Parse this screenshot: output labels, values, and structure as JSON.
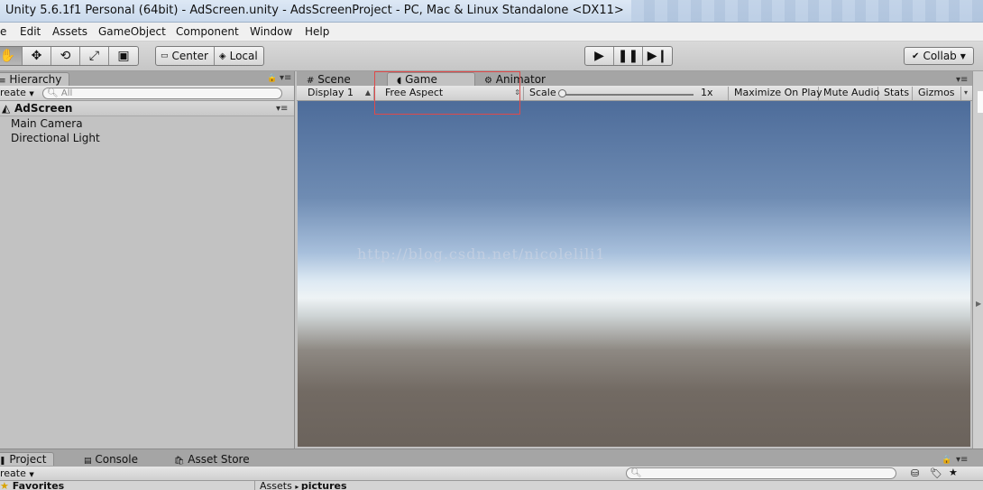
{
  "window": {
    "title": "Unity 5.6.1f1 Personal (64bit) - AdScreen.unity - AdsScreenProject - PC, Mac & Linux Standalone <DX11>"
  },
  "menu": [
    "e",
    "Edit",
    "Assets",
    "GameObject",
    "Component",
    "Window",
    "Help"
  ],
  "toolbar": {
    "transform_tools": [
      "hand-icon",
      "move-icon",
      "rotate-icon",
      "scale-icon",
      "rect-icon"
    ],
    "pivot_label": "Center",
    "space_label": "Local",
    "play_controls": [
      "play-icon",
      "pause-icon",
      "step-icon"
    ],
    "collab_label": "Collab"
  },
  "hierarchy": {
    "tab_label": "Hierarchy",
    "create_label": "reate",
    "search_placeholder": "All",
    "scene_name": "AdScreen",
    "items": [
      "Main Camera",
      "Directional Light"
    ]
  },
  "center_tabs": {
    "scene": "Scene",
    "game": "Game",
    "animator": "Animator"
  },
  "game_toolbar": {
    "display": "Display 1",
    "aspect": "Free Aspect",
    "scale_label": "Scale",
    "scale_value": "1x",
    "maximize": "Maximize On Play",
    "mute": "Mute Audio",
    "stats": "Stats",
    "gizmos": "Gizmos"
  },
  "watermark": "http://blog.csdn.net/nicolelili1",
  "project_panel": {
    "tabs": [
      "Project",
      "Console",
      "Asset Store"
    ],
    "create_label": "reate",
    "favorites_label": "Favorites",
    "breadcrumb_root": "Assets",
    "breadcrumb_folder": "pictures"
  },
  "colors": {
    "highlight_box": "#e04a4a",
    "sky_top": "#4d6c9a",
    "horizon": "#eef3f5",
    "ground": "#6b635c"
  }
}
